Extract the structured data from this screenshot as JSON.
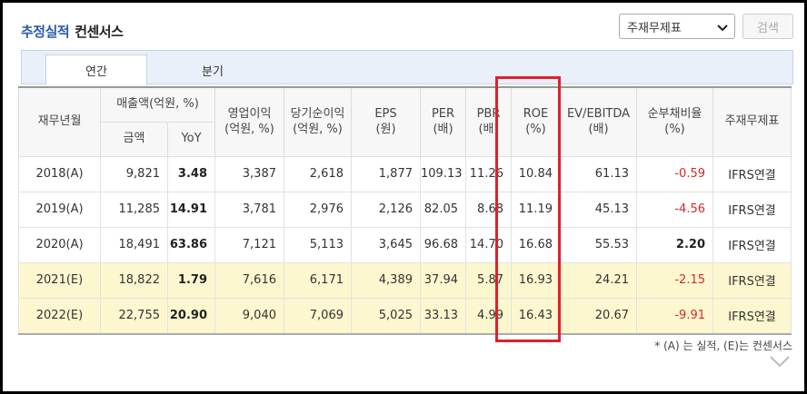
{
  "header": {
    "title_main": "추정실적",
    "title_sub": "컨센서스",
    "select_value": "주재무제표",
    "search_label": "검색"
  },
  "tabs": [
    {
      "label": "연간",
      "active": true
    },
    {
      "label": "분기",
      "active": false
    }
  ],
  "table": {
    "headers": {
      "period": "재무년월",
      "sales_group": "매출액(억원, %)",
      "sales_amount": "금액",
      "sales_yoy": "YoY",
      "op_income": "영업이익",
      "op_income_unit": "(억원, %)",
      "net_income": "당기순이익",
      "net_income_unit": "(억원, %)",
      "eps": "EPS",
      "eps_unit": "(원)",
      "per": "PER",
      "per_unit": "(배)",
      "pbr": "PBR",
      "pbr_unit": "(배)",
      "roe": "ROE",
      "roe_unit": "(%)",
      "ev_ebitda": "EV/EBITDA",
      "ev_ebitda_unit": "(배)",
      "debt_ratio": "순부채비율",
      "debt_ratio_unit": "(%)",
      "fs_type": "주재무제표"
    },
    "rows": [
      {
        "period": "2018(A)",
        "sales": "9,821",
        "yoy": "3.48",
        "op": "3,387",
        "net": "2,618",
        "eps": "1,877",
        "per": "109.13",
        "pbr": "11.26",
        "roe": "10.84",
        "ev": "61.13",
        "debt": "-0.59",
        "fs": "IFRS연결",
        "estimate": false
      },
      {
        "period": "2019(A)",
        "sales": "11,285",
        "yoy": "14.91",
        "op": "3,781",
        "net": "2,976",
        "eps": "2,126",
        "per": "82.05",
        "pbr": "8.68",
        "roe": "11.19",
        "ev": "45.13",
        "debt": "-4.56",
        "fs": "IFRS연결",
        "estimate": false
      },
      {
        "period": "2020(A)",
        "sales": "18,491",
        "yoy": "63.86",
        "op": "7,121",
        "net": "5,113",
        "eps": "3,645",
        "per": "96.68",
        "pbr": "14.70",
        "roe": "16.68",
        "ev": "55.53",
        "debt": "2.20",
        "fs": "IFRS연결",
        "estimate": false
      },
      {
        "period": "2021(E)",
        "sales": "18,822",
        "yoy": "1.79",
        "op": "7,616",
        "net": "6,171",
        "eps": "4,389",
        "per": "37.94",
        "pbr": "5.87",
        "roe": "16.93",
        "ev": "24.21",
        "debt": "-2.15",
        "fs": "IFRS연결",
        "estimate": true
      },
      {
        "period": "2022(E)",
        "sales": "22,755",
        "yoy": "20.90",
        "op": "9,040",
        "net": "7,069",
        "eps": "5,025",
        "per": "33.13",
        "pbr": "4.99",
        "roe": "16.43",
        "ev": "20.67",
        "debt": "-9.91",
        "fs": "IFRS연결",
        "estimate": true
      }
    ]
  },
  "footnote": "* (A) 는 실적, (E)는 컨센서스",
  "icons": {
    "select": "chevron-down-icon",
    "expand": "chevron-down-icon"
  },
  "colors": {
    "title": "#2b5aa8",
    "negative": "#d9282c",
    "estimate_row": "#fdf7cf",
    "highlight_box": "#e0202a"
  }
}
